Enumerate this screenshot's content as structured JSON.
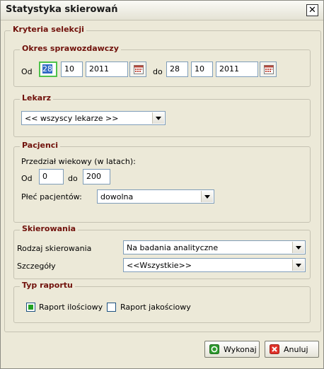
{
  "window": {
    "title": "Statystyka skierowań",
    "close_icon": "close-icon"
  },
  "criteria": {
    "legend": "Kryteria selekcji",
    "period": {
      "legend": "Okres sprawozdawczy",
      "from_label": "Od",
      "from_day": "28",
      "from_month": "10",
      "from_year": "2011",
      "to_label": "do",
      "to_day": "28",
      "to_month": "10",
      "to_year": "2011"
    },
    "doctor": {
      "legend": "Lekarz",
      "selected": "<< wszyscy lekarze >>"
    },
    "patients": {
      "legend": "Pacjenci",
      "age_range_label": "Przedział wiekowy (w latach):",
      "from_label": "Od",
      "age_from": "0",
      "to_label": "do",
      "age_to": "200",
      "gender_label": "Płeć pacjentów:",
      "gender_selected": "dowolna"
    },
    "referrals": {
      "legend": "Skierowania",
      "type_label": "Rodzaj skierowania",
      "type_selected": "Na badania analityczne",
      "details_label": "Szczegóły",
      "details_selected": "<<Wszystkie>>"
    },
    "report": {
      "legend": "Typ raportu",
      "quantitative_label": "Raport ilościowy",
      "quantitative_checked": true,
      "qualitative_label": "Raport jakościowy",
      "qualitative_checked": false
    }
  },
  "actions": {
    "execute_label": "Wykonaj",
    "cancel_label": "Anuluj"
  }
}
